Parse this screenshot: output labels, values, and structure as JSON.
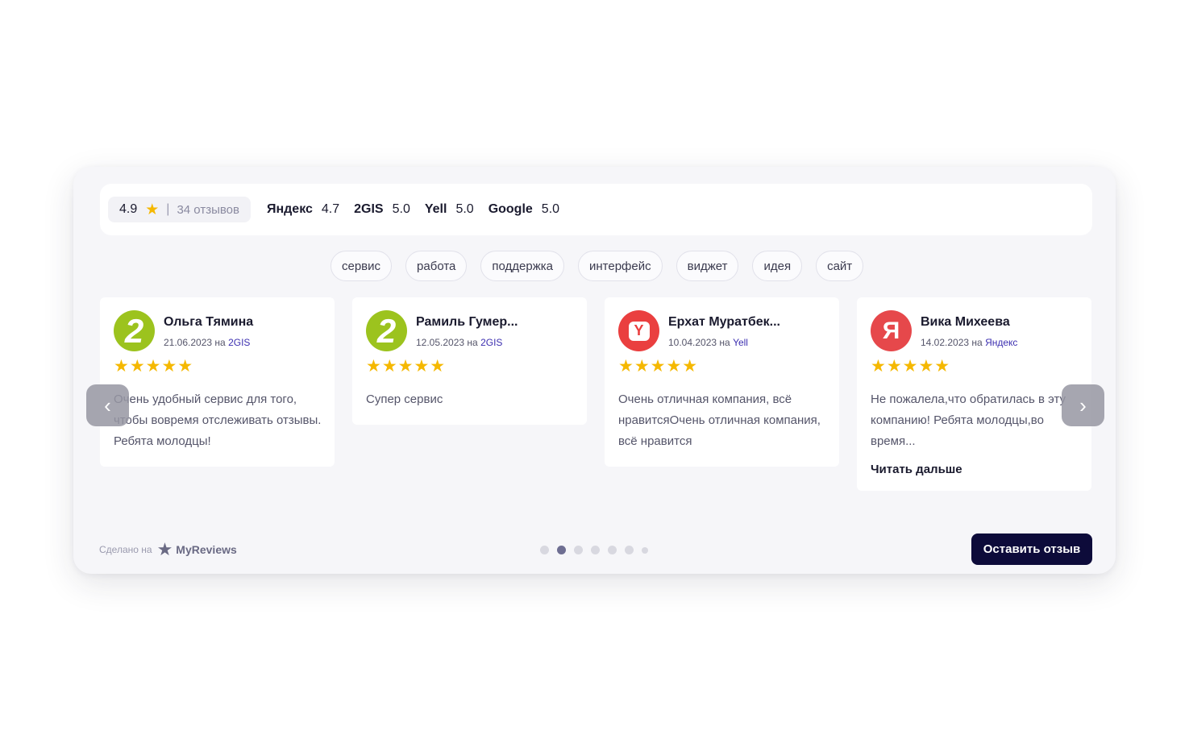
{
  "summary": {
    "rating": "4.9",
    "star_icon": "star-icon",
    "separator": "|",
    "reviews_count": "34 отзывов",
    "platforms": [
      {
        "name": "Яндекс",
        "rating": "4.7"
      },
      {
        "name": "2GIS",
        "rating": "5.0"
      },
      {
        "name": "Yell",
        "rating": "5.0"
      },
      {
        "name": "Google",
        "rating": "5.0"
      }
    ]
  },
  "tags": [
    "сервис",
    "работа",
    "поддержка",
    "интерфейс",
    "виджет",
    "идея",
    "сайт"
  ],
  "reviews": [
    {
      "name": "Ольга Тямина",
      "date": "21.06.2023",
      "on": "на",
      "source": "2GIS",
      "avatar": "2gis-logo-icon",
      "stars": "★★★★★",
      "rating": 5,
      "text": "Очень удобный сервис для того, чтобы вовремя отслеживать отзывы. Ребята молодцы!"
    },
    {
      "name": "Рамиль Гумер...",
      "date": "12.05.2023",
      "on": "на",
      "source": "2GIS",
      "avatar": "2gis-logo-icon",
      "stars": "★★★★★",
      "rating": 5,
      "text": "Супер сервис"
    },
    {
      "name": "Ерхат Муратбек...",
      "date": "10.04.2023",
      "on": "на",
      "source": "Yell",
      "avatar": "yell-logo-icon",
      "stars": "★★★★★",
      "rating": 5,
      "text": "Очень отличная компания, всё нравитсяОчень отличная компания, всё нравится"
    },
    {
      "name": "Вика Михеева",
      "date": "14.02.2023",
      "on": "на",
      "source": "Яндекс",
      "avatar": "yandex-logo-icon",
      "stars": "★★★★★",
      "rating": 5,
      "text": "Не пожалела,что обратилась в эту компанию! Ребята молодцы,во время...",
      "read_more": "Читать дальше"
    }
  ],
  "avatar_glyphs": {
    "twogis": "2",
    "yell": "Y",
    "yandex": "Я"
  },
  "nav": {
    "prev": "‹",
    "next": "›"
  },
  "footer": {
    "made_on": "Сделано на",
    "brand": "MyReviews",
    "cta": "Оставить отзыв",
    "dots_total": 7,
    "active_dot": 2
  },
  "colors": {
    "star": "#f5b800",
    "cta_bg": "#0d0b3a",
    "source_link": "#3c2fb0",
    "twogis": "#9cc31e",
    "yell": "#ea3f3f",
    "yandex": "#e6484b"
  }
}
